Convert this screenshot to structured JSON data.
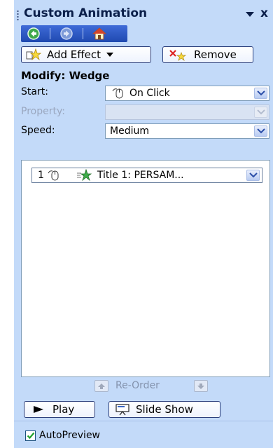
{
  "panel": {
    "title": "Custom Animation",
    "close_glyph": "x"
  },
  "navbar": {
    "back_icon": "back-arrow-icon",
    "forward_icon": "forward-arrow-icon",
    "home_icon": "home-icon"
  },
  "toolbar": {
    "add_effect_label": "Add Effect",
    "remove_label": "Remove"
  },
  "modify": {
    "heading": "Modify: Wedge",
    "start_label": "Start:",
    "start_value": "On Click",
    "property_label": "Property:",
    "property_value": "",
    "speed_label": "Speed:",
    "speed_value": "Medium"
  },
  "animation_list": {
    "items": [
      {
        "order": "1",
        "label": "Title 1: PERSAM..."
      }
    ]
  },
  "reorder": {
    "label": "Re-Order"
  },
  "footer": {
    "play_label": "Play",
    "slideshow_label": "Slide Show",
    "autopreview_label": "AutoPreview",
    "autopreview_checked": true
  },
  "colors": {
    "panel_bg": "#c3daf9",
    "nav_bg": "#1f49b0",
    "title_text": "#0b1f4a"
  }
}
